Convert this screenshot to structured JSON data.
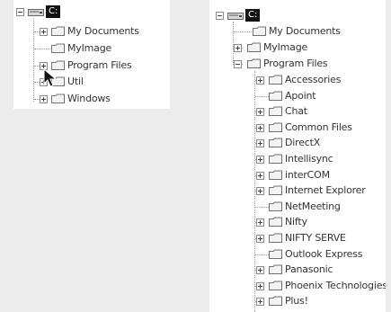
{
  "left_tree": {
    "drive_label": "C:",
    "items": [
      {
        "label": "My Documents",
        "expander": "plus"
      },
      {
        "label": "MyImage",
        "expander": "none"
      },
      {
        "label": "Program Files",
        "expander": "plus"
      },
      {
        "label": "Util",
        "expander": "plus"
      },
      {
        "label": "Windows",
        "expander": "plus"
      }
    ]
  },
  "right_tree": {
    "drive_label": "C:",
    "top_items": [
      {
        "label": "My Documents",
        "expander": "none"
      },
      {
        "label": "MyImage",
        "expander": "plus"
      },
      {
        "label": "Program Files",
        "expander": "minus"
      }
    ],
    "program_files_children": [
      {
        "label": "Accessories",
        "expander": "plus"
      },
      {
        "label": "Apoint",
        "expander": "none"
      },
      {
        "label": "Chat",
        "expander": "plus"
      },
      {
        "label": "Common Files",
        "expander": "plus"
      },
      {
        "label": "DirectX",
        "expander": "plus"
      },
      {
        "label": "Intellisync",
        "expander": "plus"
      },
      {
        "label": "interCOM",
        "expander": "plus"
      },
      {
        "label": "Internet Explorer",
        "expander": "plus"
      },
      {
        "label": "NetMeeting",
        "expander": "none"
      },
      {
        "label": "Nifty",
        "expander": "plus"
      },
      {
        "label": "NIFTY SERVE",
        "expander": "plus"
      },
      {
        "label": "Outlook Express",
        "expander": "none"
      },
      {
        "label": "Panasonic",
        "expander": "plus"
      },
      {
        "label": "Phoenix Technologies",
        "expander": "plus"
      },
      {
        "label": "Plus!",
        "expander": "plus"
      }
    ]
  },
  "colors": {
    "background": "#ececec",
    "panel": "#ffffff",
    "folder_fill": "#f3f3f3",
    "folder_stroke": "#707070",
    "drive_label_bg": "#111111"
  },
  "icons": {
    "folder": "folder-icon",
    "drive": "drive-icon",
    "cursor": "mouse-pointer-icon",
    "expand": "expand-plus-icon",
    "collapse": "collapse-minus-icon"
  }
}
